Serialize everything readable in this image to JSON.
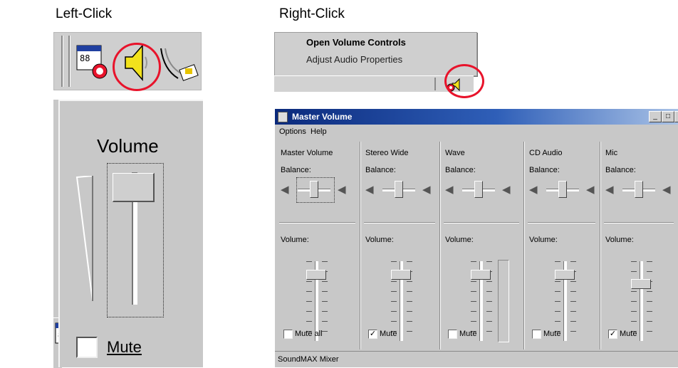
{
  "captions": {
    "left_click": "Left-Click",
    "right_click": "Right-Click"
  },
  "context_menu": {
    "items": [
      "Open Volume Controls",
      "Adjust Audio Properties"
    ]
  },
  "volume_popup": {
    "title": "Volume",
    "mute_label": "Mute",
    "mute_checked": false,
    "level": 0.96
  },
  "mixer": {
    "title": "Master Volume",
    "menu": [
      "Options",
      "Help"
    ],
    "window_buttons": [
      "minimize",
      "maximize",
      "close"
    ],
    "balance_label": "Balance:",
    "volume_label": "Volume:",
    "channels": [
      {
        "name": "Master Volume",
        "mute_label": "Mute all",
        "muted": false,
        "level": 0.88
      },
      {
        "name": "Stereo Wide",
        "mute_label": "Mute",
        "muted": true,
        "level": 0.88
      },
      {
        "name": "Wave",
        "mute_label": "Mute",
        "muted": false,
        "level": 0.88
      },
      {
        "name": "CD Audio",
        "mute_label": "Mute",
        "muted": false,
        "level": 0.88
      },
      {
        "name": "Mic",
        "mute_label": "Mute",
        "muted": true,
        "level": 0.75
      }
    ],
    "status": "SoundMAX Mixer"
  },
  "colors": {
    "highlight_circle": "#e8132b",
    "titlebar": "#0b2a7c"
  }
}
